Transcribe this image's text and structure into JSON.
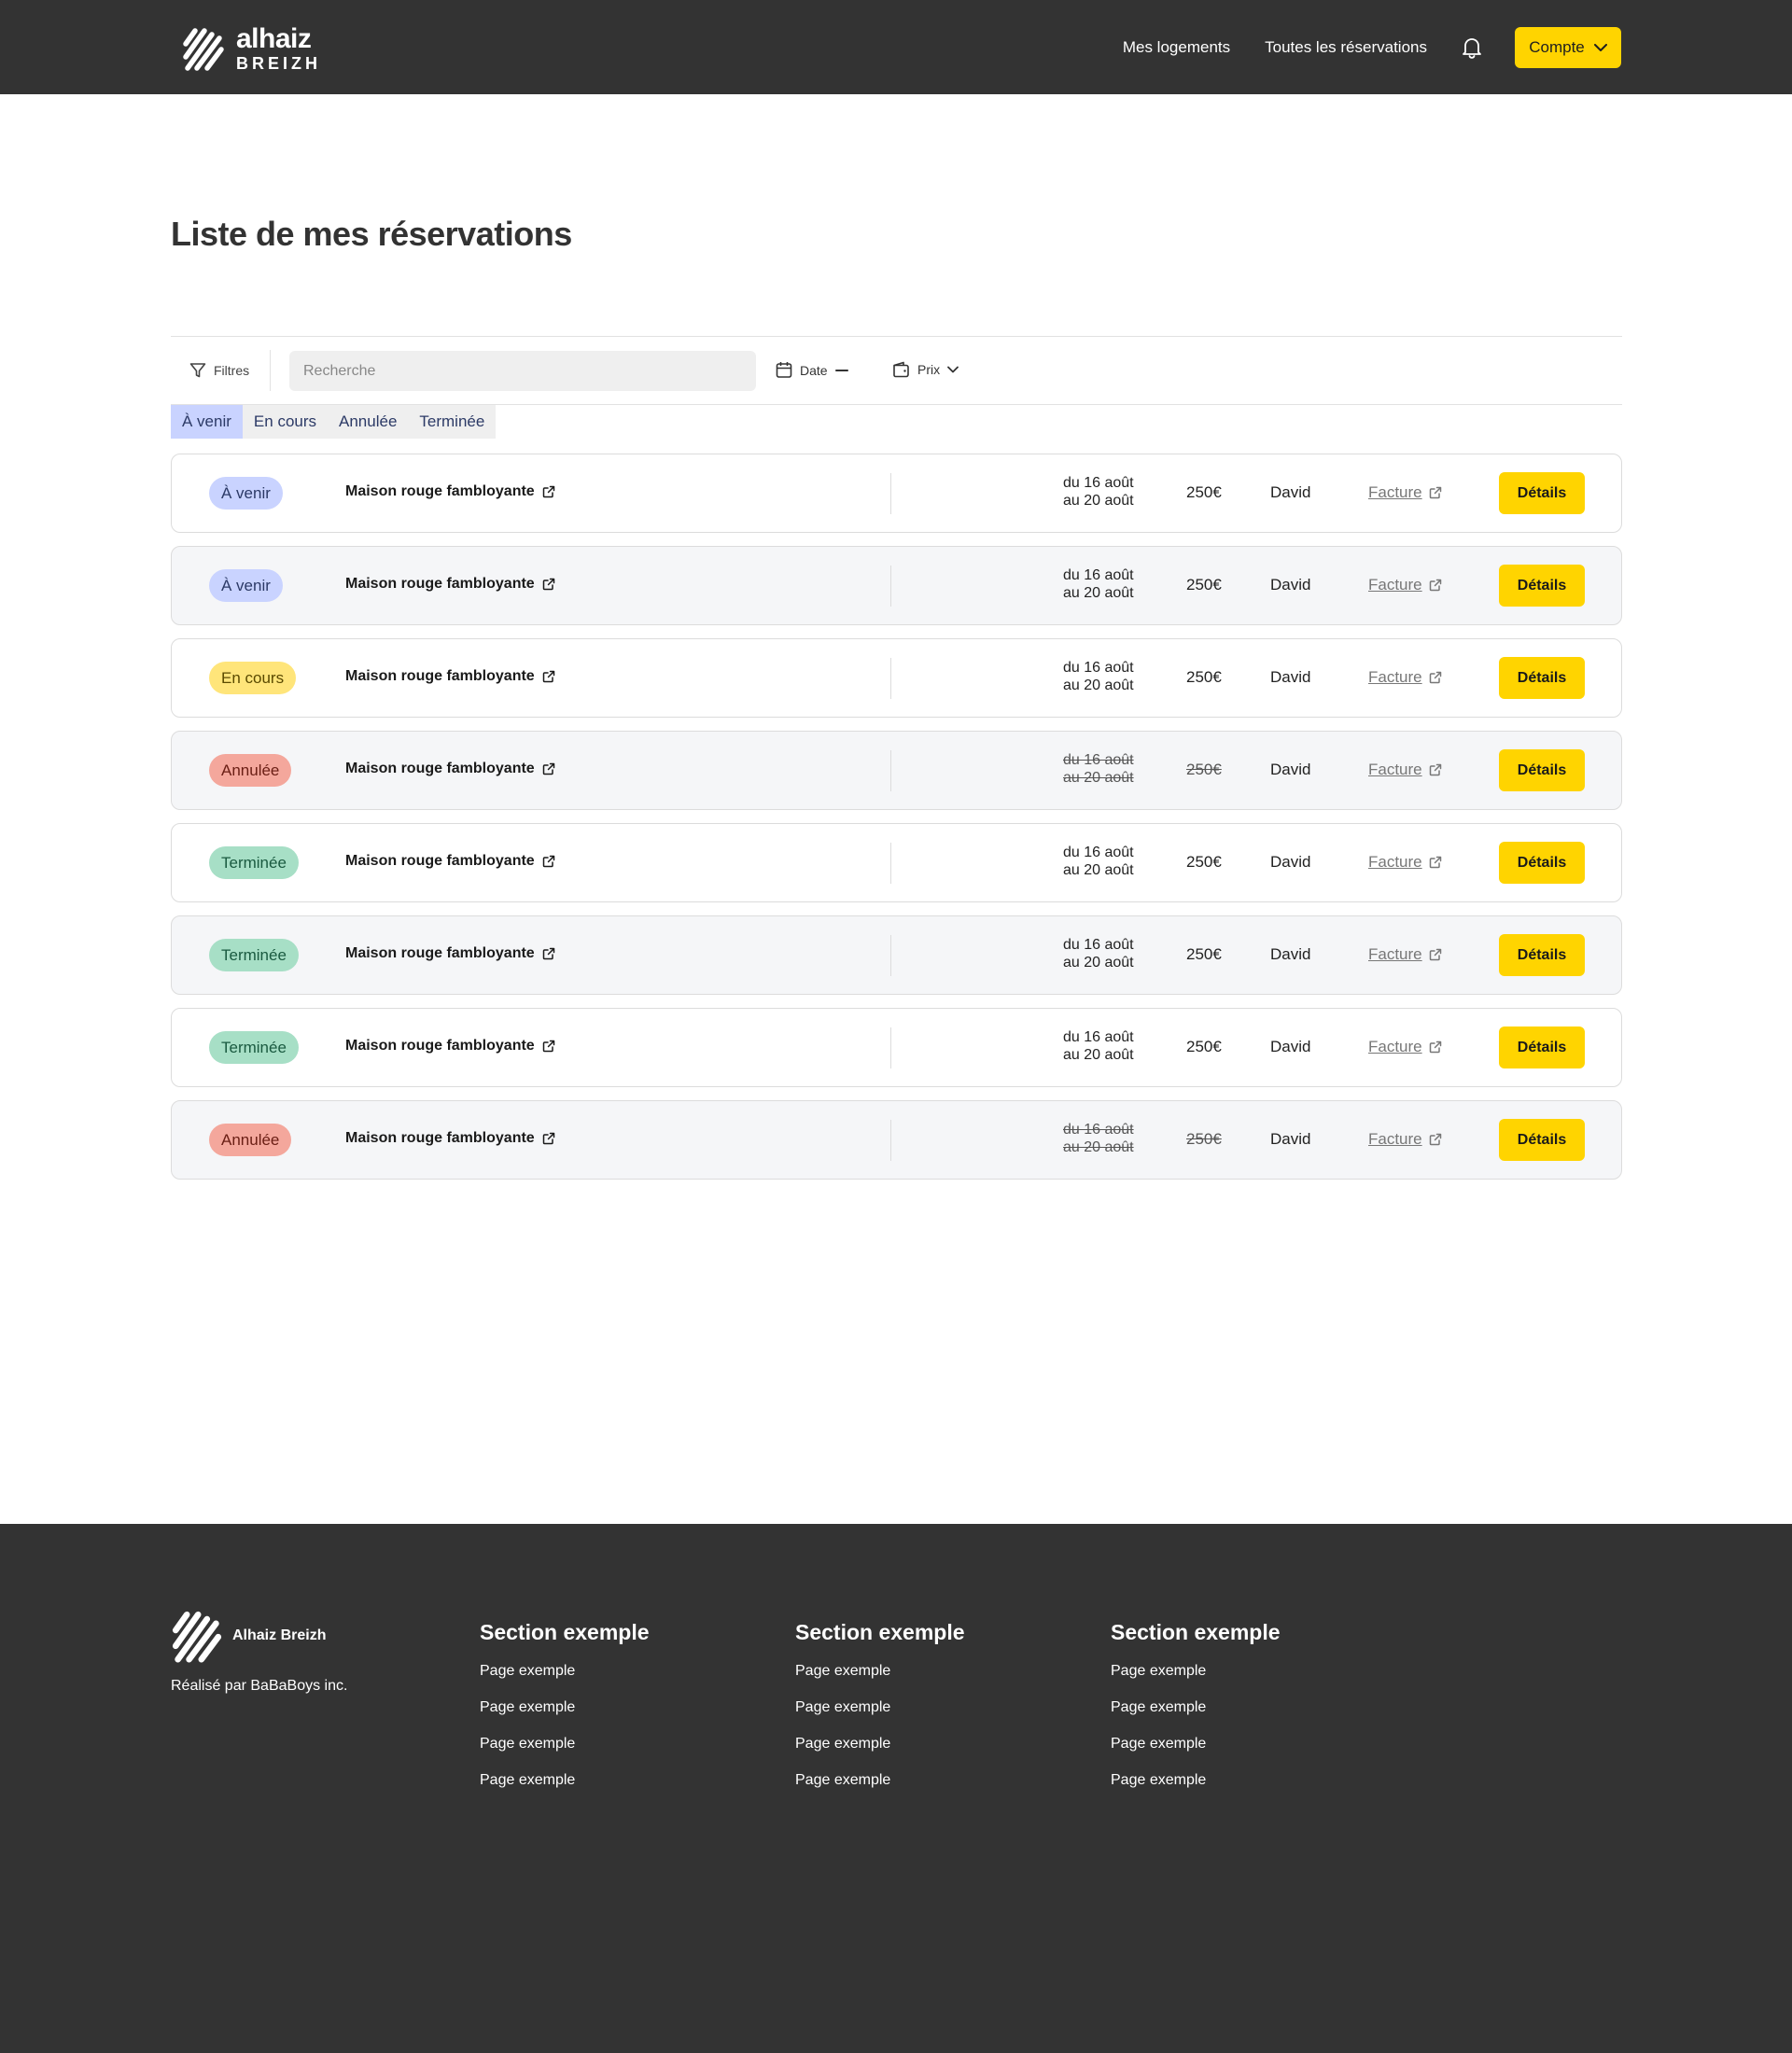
{
  "header": {
    "logo_line1": "alhaiz",
    "logo_line2": "BREIZH",
    "nav": [
      "Mes logements",
      "Toutes les réservations"
    ],
    "account_label": "Compte"
  },
  "page_title": "Liste de mes réservations",
  "filterbar": {
    "filters_label": "Filtres",
    "search_placeholder": "Recherche",
    "date_label": "Date",
    "price_label": "Prix"
  },
  "tabs": [
    {
      "label": "À venir",
      "active": true
    },
    {
      "label": "En cours",
      "active": false
    },
    {
      "label": "Annulée",
      "active": false
    },
    {
      "label": "Terminée",
      "active": false
    }
  ],
  "reservations": [
    {
      "status": "À venir",
      "status_kind": "upcoming",
      "house": "Maison rouge fambloyante",
      "date_from": "du 16 août",
      "date_to": "au 20 août",
      "price": "250€",
      "guest": "David",
      "invoice": "Facture",
      "details": "Détails"
    },
    {
      "status": "À venir",
      "status_kind": "upcoming",
      "house": "Maison rouge fambloyante",
      "date_from": "du 16 août",
      "date_to": "au 20 août",
      "price": "250€",
      "guest": "David",
      "invoice": "Facture",
      "details": "Détails"
    },
    {
      "status": "En cours",
      "status_kind": "ongoing",
      "house": "Maison rouge fambloyante",
      "date_from": "du 16 août",
      "date_to": "au 20 août",
      "price": "250€",
      "guest": "David",
      "invoice": "Facture",
      "details": "Détails"
    },
    {
      "status": "Annulée",
      "status_kind": "cancelled",
      "house": "Maison rouge fambloyante",
      "date_from": "du 16 août",
      "date_to": "au 20 août",
      "price": "250€",
      "guest": "David",
      "invoice": "Facture",
      "details": "Détails"
    },
    {
      "status": "Terminée",
      "status_kind": "done",
      "house": "Maison rouge fambloyante",
      "date_from": "du 16 août",
      "date_to": "au 20 août",
      "price": "250€",
      "guest": "David",
      "invoice": "Facture",
      "details": "Détails"
    },
    {
      "status": "Terminée",
      "status_kind": "done",
      "house": "Maison rouge fambloyante",
      "date_from": "du 16 août",
      "date_to": "au 20 août",
      "price": "250€",
      "guest": "David",
      "invoice": "Facture",
      "details": "Détails"
    },
    {
      "status": "Terminée",
      "status_kind": "done",
      "house": "Maison rouge fambloyante",
      "date_from": "du 16 août",
      "date_to": "au 20 août",
      "price": "250€",
      "guest": "David",
      "invoice": "Facture",
      "details": "Détails"
    },
    {
      "status": "Annulée",
      "status_kind": "cancelled",
      "house": "Maison rouge fambloyante",
      "date_from": "du 16 août",
      "date_to": "au 20 août",
      "price": "250€",
      "guest": "David",
      "invoice": "Facture",
      "details": "Détails"
    }
  ],
  "footer": {
    "brand": "Alhaiz Breizh",
    "credit": "Réalisé par BaBaBoys inc.",
    "sections": [
      {
        "title": "Section exemple",
        "links": [
          "Page exemple",
          "Page exemple",
          "Page exemple",
          "Page exemple"
        ]
      },
      {
        "title": "Section exemple",
        "links": [
          "Page exemple",
          "Page exemple",
          "Page exemple",
          "Page exemple"
        ]
      },
      {
        "title": "Section exemple",
        "links": [
          "Page exemple",
          "Page exemple",
          "Page exemple",
          "Page exemple"
        ]
      }
    ]
  },
  "colors": {
    "dark": "#333333",
    "accent_yellow": "#ffd400",
    "upcoming": "#c9d3ff",
    "ongoing": "#ffe57a",
    "cancelled": "#f4a79c",
    "done": "#a7dfc6"
  },
  "icons": [
    "logo-stripes-icon",
    "bell-icon",
    "chevron-down-icon",
    "filter-icon",
    "calendar-icon",
    "minus-icon",
    "wallet-icon",
    "external-link-icon"
  ]
}
